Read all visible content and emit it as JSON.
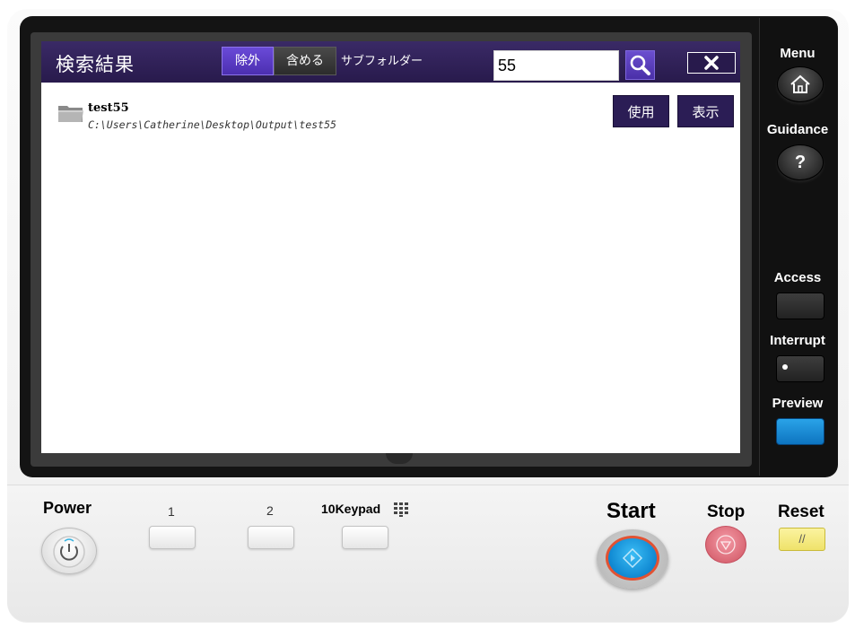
{
  "dialog": {
    "title": "検索結果",
    "segment_exclude": "除外",
    "segment_include": "含める",
    "subfolder_label": "サブフォルダー",
    "search_value": "55",
    "close_icon": "close-icon",
    "search_icon": "magnifier-icon"
  },
  "result": {
    "name": "test55",
    "path": "C:\\Users\\Catherine\\Desktop\\Output\\test55",
    "use_label": "使用",
    "show_label": "表示",
    "icon": "folder-icon"
  },
  "side_panel": {
    "menu": "Menu",
    "guidance": "Guidance",
    "guidance_symbol": "?",
    "access": "Access",
    "interrupt": "Interrupt",
    "preview": "Preview"
  },
  "lower_panel": {
    "power": "Power",
    "button_1": "1",
    "button_2": "2",
    "keypad": "10Keypad",
    "start": "Start",
    "stop": "Stop",
    "reset": "Reset",
    "reset_symbol": "//"
  },
  "colors": {
    "titlebar": "#281a4c",
    "accent": "#5b3cc4",
    "start_blue": "#0c84cf",
    "preview_blue": "#1a8ad6"
  }
}
